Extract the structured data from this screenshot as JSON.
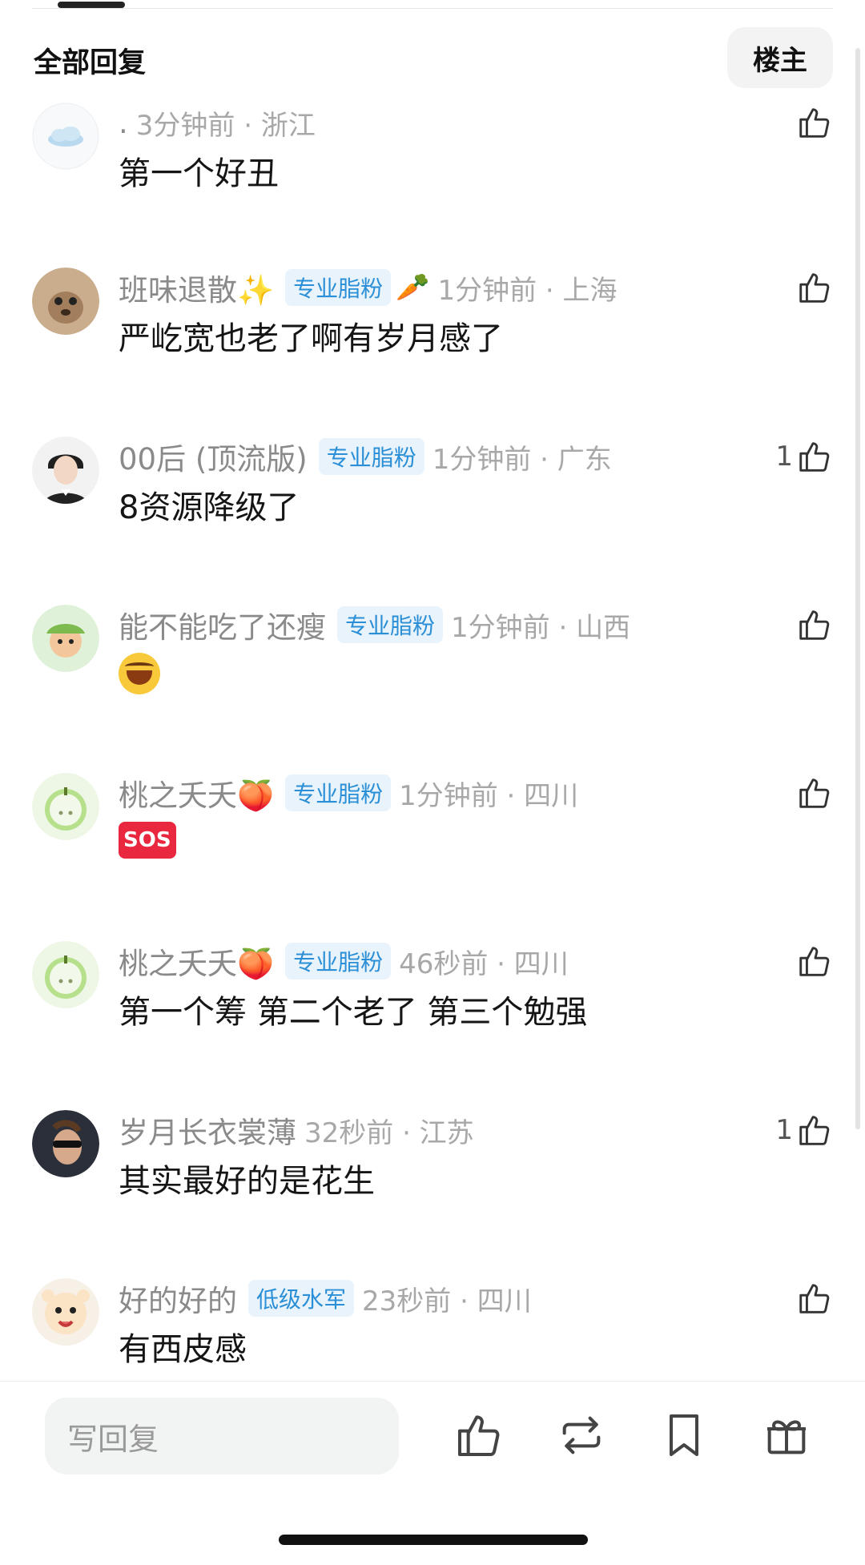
{
  "header": {
    "title": "全部回复",
    "op_button": "楼主"
  },
  "comments": [
    {
      "name": ".",
      "badge": "",
      "deco": "",
      "time": "3分钟前 · 浙江",
      "body": "第一个好丑",
      "likes": ""
    },
    {
      "name": "班味退散✨",
      "badge": "专业脂粉",
      "deco": "🥕",
      "time": "1分钟前 · 上海",
      "body": "严屹宽也老了啊有岁月感了",
      "likes": ""
    },
    {
      "name": "00后 (顶流版)",
      "badge": "专业脂粉",
      "deco": "",
      "time": "1分钟前 · 广东",
      "body": "8资源降级了",
      "likes": "1"
    },
    {
      "name": "能不能吃了还瘦",
      "badge": "专业脂粉",
      "deco": "",
      "time": "1分钟前 · 山西",
      "body": "",
      "body_emoji": "laughing-emoji",
      "likes": ""
    },
    {
      "name": "桃之夭夭🍑",
      "badge": "专业脂粉",
      "deco": "",
      "time": "1分钟前 · 四川",
      "body": "",
      "body_emoji": "sos-emoji",
      "sos_text": "SOS",
      "likes": ""
    },
    {
      "name": "桃之夭夭🍑",
      "badge": "专业脂粉",
      "deco": "",
      "time": "46秒前 · 四川",
      "body": "第一个筹 第二个老了 第三个勉强",
      "likes": ""
    },
    {
      "name": "岁月长衣裳薄",
      "badge": "",
      "deco": "",
      "time": "32秒前 · 江苏",
      "body": "其实最好的是花生",
      "likes": "1"
    },
    {
      "name": "好的好的",
      "badge": "低级水军",
      "deco": "",
      "time": "23秒前 · 四川",
      "body": "有西皮感",
      "likes": ""
    }
  ],
  "footer": {
    "reply_placeholder": "写回复",
    "actions": [
      "like-icon",
      "repost-icon",
      "bookmark-icon",
      "gift-icon"
    ]
  },
  "colors": {
    "badge_text": "#2a8fd6",
    "badge_bg": "#e9f3fb",
    "reply_bg": "#f1f4f2"
  }
}
